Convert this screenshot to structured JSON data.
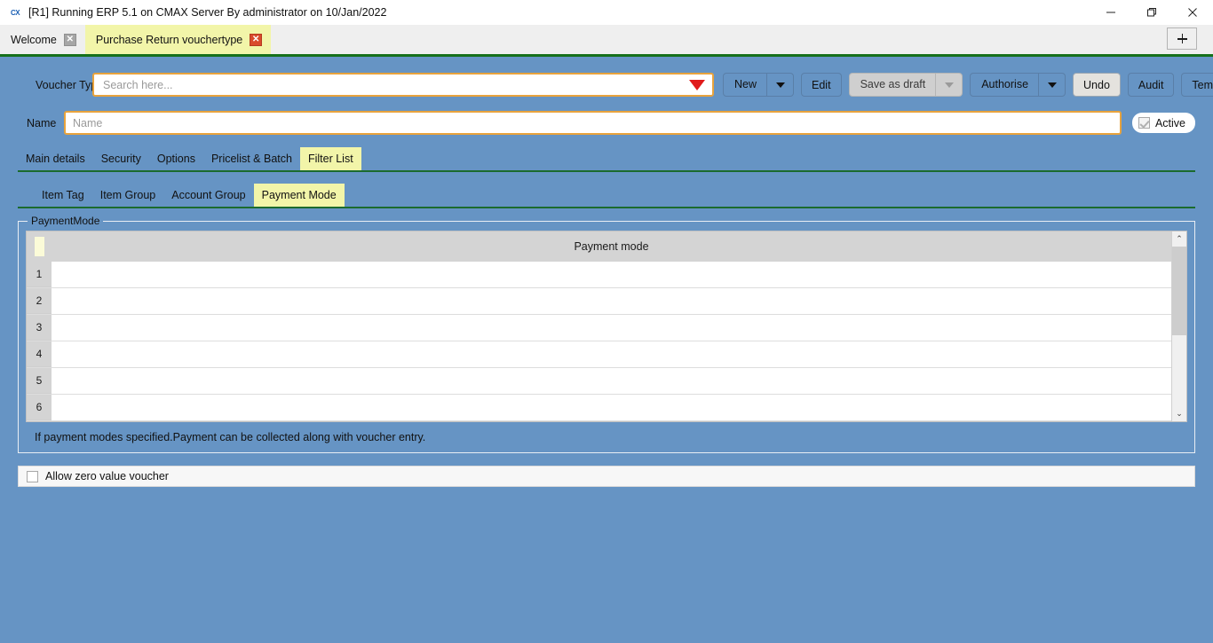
{
  "window": {
    "title": "[R1] Running ERP 5.1 on CMAX Server By administrator on 10/Jan/2022",
    "logo_text": "CX",
    "minimize_label": "Minimize",
    "maximize_label": "Restore",
    "close_label": "Close"
  },
  "doc_tabs": {
    "items": [
      {
        "label": "Welcome",
        "active": false
      },
      {
        "label": "Purchase Return vouchertype",
        "active": true
      }
    ],
    "close_glyph": "✕",
    "new_tab_label": "New tab"
  },
  "form": {
    "voucher_type_label": "Voucher Type",
    "search_placeholder": "Search here...",
    "search_value": "",
    "name_label": "Name",
    "name_placeholder": "Name",
    "name_value": "",
    "active_label": "Active",
    "active_checked": true
  },
  "toolbar": {
    "new_label": "New",
    "edit_label": "Edit",
    "save_as_draft_label": "Save as draft",
    "authorise_label": "Authorise",
    "undo_label": "Undo",
    "audit_label": "Audit",
    "template_label": "Template"
  },
  "primary_tabs": [
    {
      "label": "Main details",
      "active": false
    },
    {
      "label": "Security",
      "active": false
    },
    {
      "label": "Options",
      "active": false
    },
    {
      "label": "Pricelist & Batch",
      "active": false
    },
    {
      "label": "Filter List",
      "active": true
    }
  ],
  "secondary_tabs": [
    {
      "label": "Item Tag",
      "active": false
    },
    {
      "label": "Item Group",
      "active": false
    },
    {
      "label": "Account Group",
      "active": false
    },
    {
      "label": "Payment Mode",
      "active": true
    }
  ],
  "payment_mode_group": {
    "legend": "PaymentMode",
    "grid": {
      "columns": [
        "Payment mode"
      ],
      "row_numbers": [
        "1",
        "2",
        "3",
        "4",
        "5",
        "6"
      ],
      "rows": [
        {
          "payment_mode": ""
        },
        {
          "payment_mode": ""
        },
        {
          "payment_mode": ""
        },
        {
          "payment_mode": ""
        },
        {
          "payment_mode": ""
        },
        {
          "payment_mode": ""
        }
      ]
    },
    "scrollbar": {
      "up_glyph": "⌃",
      "down_glyph": "⌄"
    },
    "note": "If payment modes specified.Payment can be collected along with voucher entry."
  },
  "footer": {
    "allow_zero_value_label": "Allow zero value voucher",
    "allow_zero_value_checked": false
  },
  "colors": {
    "canvas": "#6694c4",
    "active_tab": "#f2f5a9",
    "rule_green": "#15701b",
    "field_border": "#e8a33d",
    "caret_red": "#e01b1b"
  }
}
